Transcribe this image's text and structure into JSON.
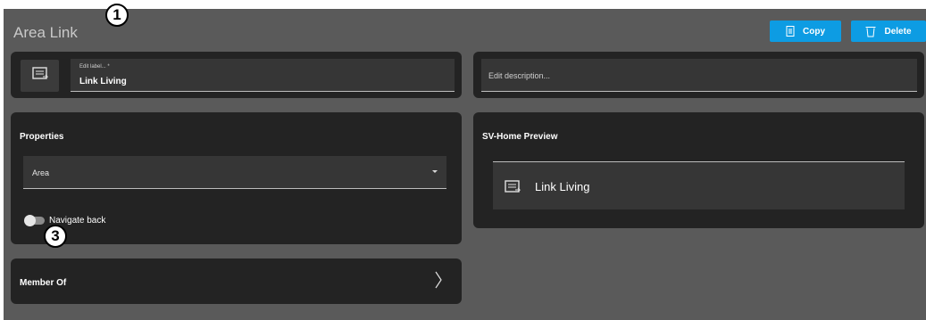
{
  "page": {
    "title": "Area Link"
  },
  "annotations": {
    "badge_1": "1",
    "badge_3": "3"
  },
  "toolbar": {
    "copy_label": "Copy",
    "delete_label": "Delete",
    "accent_color": "#0d9ce3"
  },
  "label_card": {
    "field_label": "Edit label... *",
    "value": "Link Living",
    "icon": "area-link-icon"
  },
  "description_card": {
    "placeholder": "Edit description..."
  },
  "properties": {
    "title": "Properties",
    "select_value": "Area",
    "toggle_label": "Navigate back",
    "toggle_on": false
  },
  "preview": {
    "title": "SV-Home Preview",
    "item_label": "Link Living",
    "icon": "area-link-icon"
  },
  "member_of": {
    "title": "Member Of",
    "icon": "chevron-right-icon"
  }
}
